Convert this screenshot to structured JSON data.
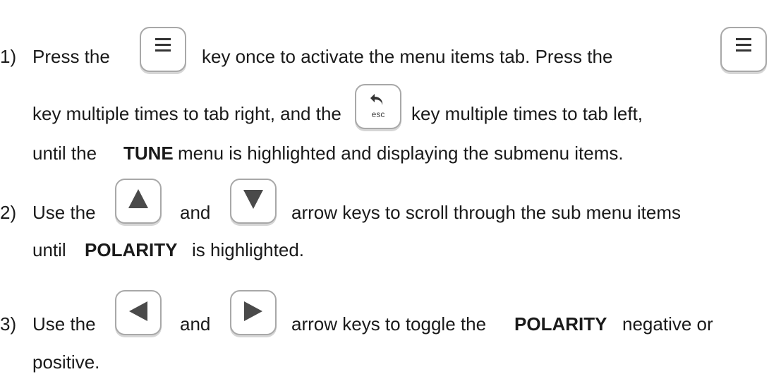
{
  "steps": [
    {
      "number": "1)",
      "parts": {
        "a": "Press the",
        "b": "key once to activate the menu items tab.  Press the",
        "c": "key multiple times to tab right, and the",
        "d": "key multiple times to tab left,",
        "e": "until the",
        "f": "TUNE",
        "g": "menu is highlighted and displaying the submenu items."
      },
      "keys": {
        "menu": "menu-icon",
        "esc": "esc"
      }
    },
    {
      "number": "2)",
      "parts": {
        "a": "Use the",
        "b": "and",
        "c": "arrow keys to scroll through the sub menu items",
        "d": "until",
        "e": "POLARITY",
        "f": "is highlighted."
      },
      "keys": {
        "up": "arrow-up-icon",
        "down": "arrow-down-icon"
      }
    },
    {
      "number": "3)",
      "parts": {
        "a": "Use the",
        "b": "and",
        "c": "arrow keys to toggle the",
        "d": "POLARITY",
        "e": "negative or",
        "f": "positive."
      },
      "keys": {
        "left": "arrow-left-icon",
        "right": "arrow-right-icon"
      }
    }
  ]
}
